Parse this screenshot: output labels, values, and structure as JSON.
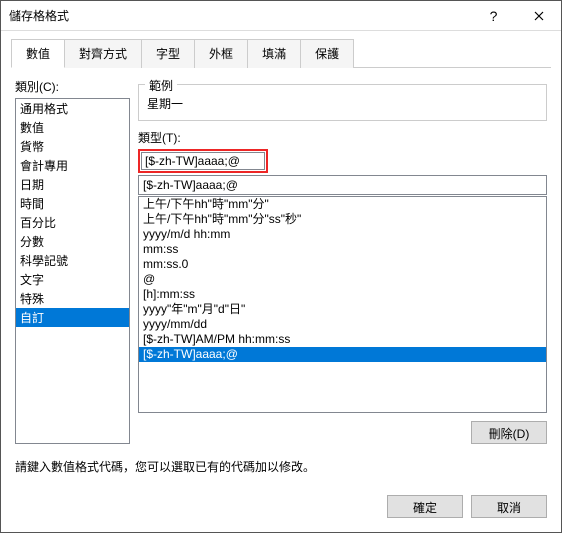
{
  "window_title": "儲存格格式",
  "tabs": [
    "數值",
    "對齊方式",
    "字型",
    "外框",
    "填滿",
    "保護"
  ],
  "active_tab_index": 0,
  "category_label": "類別(C):",
  "categories": [
    "通用格式",
    "數值",
    "貨幣",
    "會計專用",
    "日期",
    "時間",
    "百分比",
    "分數",
    "科學記號",
    "文字",
    "特殊",
    "自訂"
  ],
  "selected_category_index": 11,
  "sample_label": "範例",
  "sample_value": "星期一",
  "type_label": "類型(T):",
  "type_value": "[$-zh-TW]aaaa;@",
  "type_options": [
    "上午/下午hh\"時\"mm\"分\"",
    "上午/下午hh\"時\"mm\"分\"ss\"秒\"",
    "yyyy/m/d hh:mm",
    "mm:ss",
    "mm:ss.0",
    "@",
    "[h]:mm:ss",
    "yyyy\"年\"m\"月\"d\"日\"",
    "yyyy/mm/dd",
    "[$-zh-TW]AM/PM hh:mm:ss",
    "[$-zh-TW]aaaa;@"
  ],
  "selected_type_index": 10,
  "delete_button": "刪除(D)",
  "hint_text": "請鍵入數值格式代碼，您可以選取已有的代碼加以修改。",
  "ok_button": "確定",
  "cancel_button": "取消"
}
